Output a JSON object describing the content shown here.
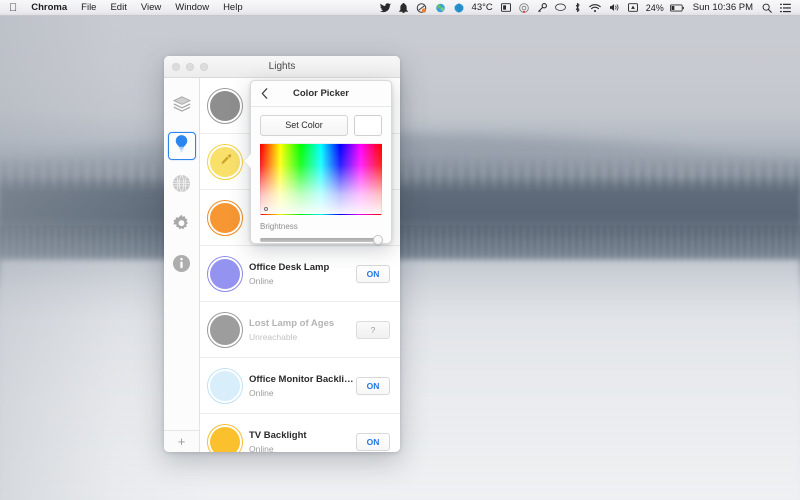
{
  "menubar": {
    "apple_icon": "apple-logo",
    "items": [
      {
        "label": "Chroma",
        "bold": true
      },
      {
        "label": "File",
        "bold": false
      },
      {
        "label": "Edit",
        "bold": false
      },
      {
        "label": "View",
        "bold": false
      },
      {
        "label": "Window",
        "bold": false
      },
      {
        "label": "Help",
        "bold": false
      }
    ],
    "status": {
      "twitter_icon": "twitter-bird-icon",
      "bell_icon": "bell-icon",
      "dropbox_icon": "cloud-sync-icon",
      "sync_icon": "sync-icon",
      "weather_icon": "globe-icon",
      "temperature": "43°C",
      "display_icon": "display-icon",
      "record_icon": "record-icon",
      "key_icon": "key-icon",
      "chat_icon": "chat-bubble-icon",
      "bluetooth_icon": "bluetooth-icon",
      "wifi_icon": "wifi-icon",
      "volume_icon": "volume-icon",
      "airplay_icon": "airplay-icon",
      "battery_percent": "24%",
      "battery_icon": "battery-icon",
      "clock": "Sun 10:36 PM",
      "search_icon": "search-icon",
      "notifications_icon": "notification-center-icon"
    }
  },
  "window": {
    "title": "Lights",
    "traffic_lights": [
      "close-button",
      "minimize-button",
      "zoom-button"
    ],
    "sidebar": {
      "items": [
        {
          "name": "sidebar-item-scenes",
          "icon": "layers-icon",
          "active": false
        },
        {
          "name": "sidebar-item-lights",
          "icon": "lightbulb-icon",
          "active": true
        },
        {
          "name": "sidebar-item-network",
          "icon": "globe-icon",
          "active": false
        },
        {
          "name": "sidebar-item-settings",
          "icon": "gear-icon",
          "active": false
        },
        {
          "name": "sidebar-item-info",
          "icon": "info-icon",
          "active": false
        }
      ],
      "add_label": "+"
    },
    "lights": [
      {
        "name": "",
        "status": "",
        "color": "#8e8e8e",
        "ring": "ring-grey",
        "button": "",
        "hidden_behind_popover": true,
        "eyedropper": false
      },
      {
        "name": "",
        "status": "",
        "color": "#f8e06a",
        "ring": "ring-yellow",
        "button": "",
        "hidden_behind_popover": true,
        "eyedropper": true
      },
      {
        "name": "",
        "status": "",
        "color": "#f79734",
        "ring": "ring-orange",
        "button": "",
        "hidden_behind_popover": true,
        "eyedropper": false
      },
      {
        "name": "Office Desk Lamp",
        "status": "Online",
        "color": "#9494f0",
        "ring": "ring-purple",
        "button": "ON",
        "disabled": false
      },
      {
        "name": "Lost Lamp of Ages",
        "status": "Unreachable",
        "color": "#9d9d9d",
        "ring": "ring-grey",
        "button": "?",
        "disabled": true
      },
      {
        "name": "Office Monitor Backlight",
        "status": "Online",
        "color": "#d8eefb",
        "ring": "ring-lblue",
        "button": "ON",
        "disabled": false
      },
      {
        "name": "TV Backlight",
        "status": "Online",
        "color": "#fbc02d",
        "ring": "ring-amber",
        "button": "ON",
        "disabled": false
      }
    ]
  },
  "popover": {
    "back_icon": "chevron-left-icon",
    "title": "Color Picker",
    "set_color_label": "Set Color",
    "swatch_color": "#ffffff",
    "brightness_label": "Brightness",
    "brightness_value": 100
  }
}
